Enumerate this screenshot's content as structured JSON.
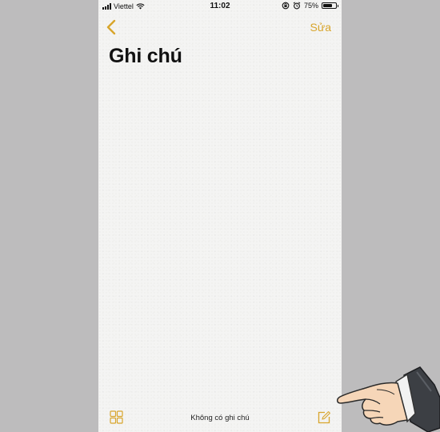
{
  "status_bar": {
    "carrier": "Viettel",
    "time": "11:02",
    "battery_percent": "75%",
    "battery_level": 0.75,
    "icons": [
      "signal-icon",
      "wifi-icon",
      "rotation-lock-icon",
      "alarm-icon",
      "battery-icon"
    ]
  },
  "nav": {
    "back_icon": "chevron-left-icon",
    "edit_label": "Sửa"
  },
  "page": {
    "title": "Ghi chú"
  },
  "toolbar": {
    "gallery_icon": "grid-icon",
    "empty_text": "Không có ghi chú",
    "compose_icon": "compose-icon"
  },
  "colors": {
    "accent": "#d8a52b",
    "page_background": "#f4f4f3",
    "outer_background": "#bdbcbd"
  }
}
